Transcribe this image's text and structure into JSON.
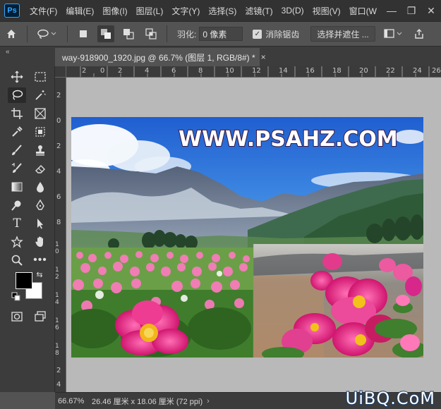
{
  "app": {
    "logo": "Ps",
    "menu": [
      "文件(F)",
      "编辑(E)",
      "图像(I)",
      "图层(L)",
      "文字(Y)",
      "选择(S)",
      "滤镜(T)",
      "3D(D)",
      "视图(V)",
      "窗口(W"
    ]
  },
  "window_controls": {
    "minimize": "—",
    "restore": "❐",
    "close": "✕"
  },
  "options_bar": {
    "feather_label": "羽化:",
    "feather_value": "0 像素",
    "antialias_label": "消除锯齿",
    "antialias_checked": true,
    "select_mask_label": "选择并遮住 ..."
  },
  "document_tab": {
    "title": "way-918900_1920.jpg @ 66.7% (图层 1, RGB/8#) *",
    "close": "×"
  },
  "ruler": {
    "h_labels": [
      "2",
      "0",
      "2",
      "4",
      "6",
      "8",
      "10",
      "12",
      "14",
      "16",
      "18",
      "20",
      "22",
      "24",
      "26"
    ],
    "v_labels": [
      "2",
      "0",
      "2",
      "4",
      "6",
      "8",
      "10",
      "12",
      "14",
      "16",
      "18",
      "2",
      "4"
    ]
  },
  "canvas": {
    "watermark": "WWW.PSAHZ.COM"
  },
  "status": {
    "zoom": "66.67%",
    "size": "26.46 厘米 x 18.06 厘米 (72 ppi)",
    "arrow": "›"
  },
  "site_mark": "UiBQ.CoM",
  "colors": {
    "foreground": "#000000",
    "background": "#ffffff",
    "accent": "#31a8ff"
  }
}
